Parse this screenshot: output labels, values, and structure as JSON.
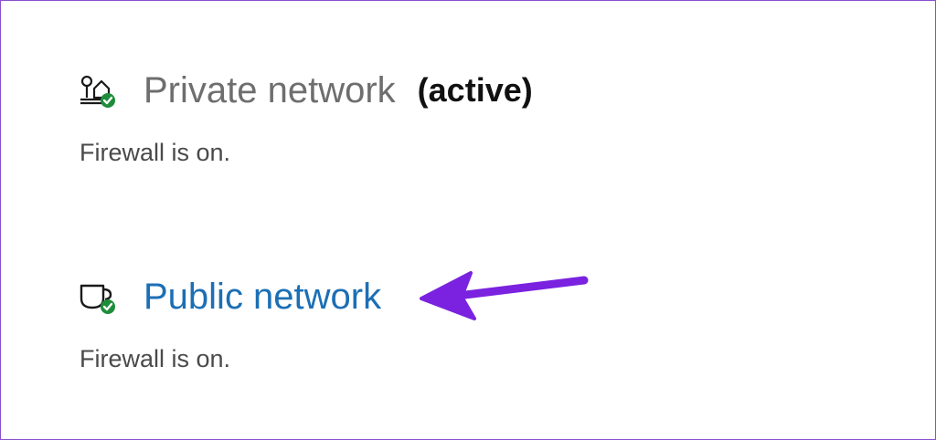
{
  "private_network": {
    "icon": "private-network-shield-icon",
    "title": "Private network",
    "active_label": "(active)",
    "status": "Firewall is on."
  },
  "public_network": {
    "icon": "public-network-shield-icon",
    "title": "Public network",
    "status": "Firewall is on."
  },
  "annotation": {
    "icon": "arrow-left-icon",
    "color": "#7a22e0"
  },
  "colors": {
    "link": "#1c6fb5",
    "check_badge": "#1e8c3a",
    "frame_border": "#8a4fcf"
  }
}
